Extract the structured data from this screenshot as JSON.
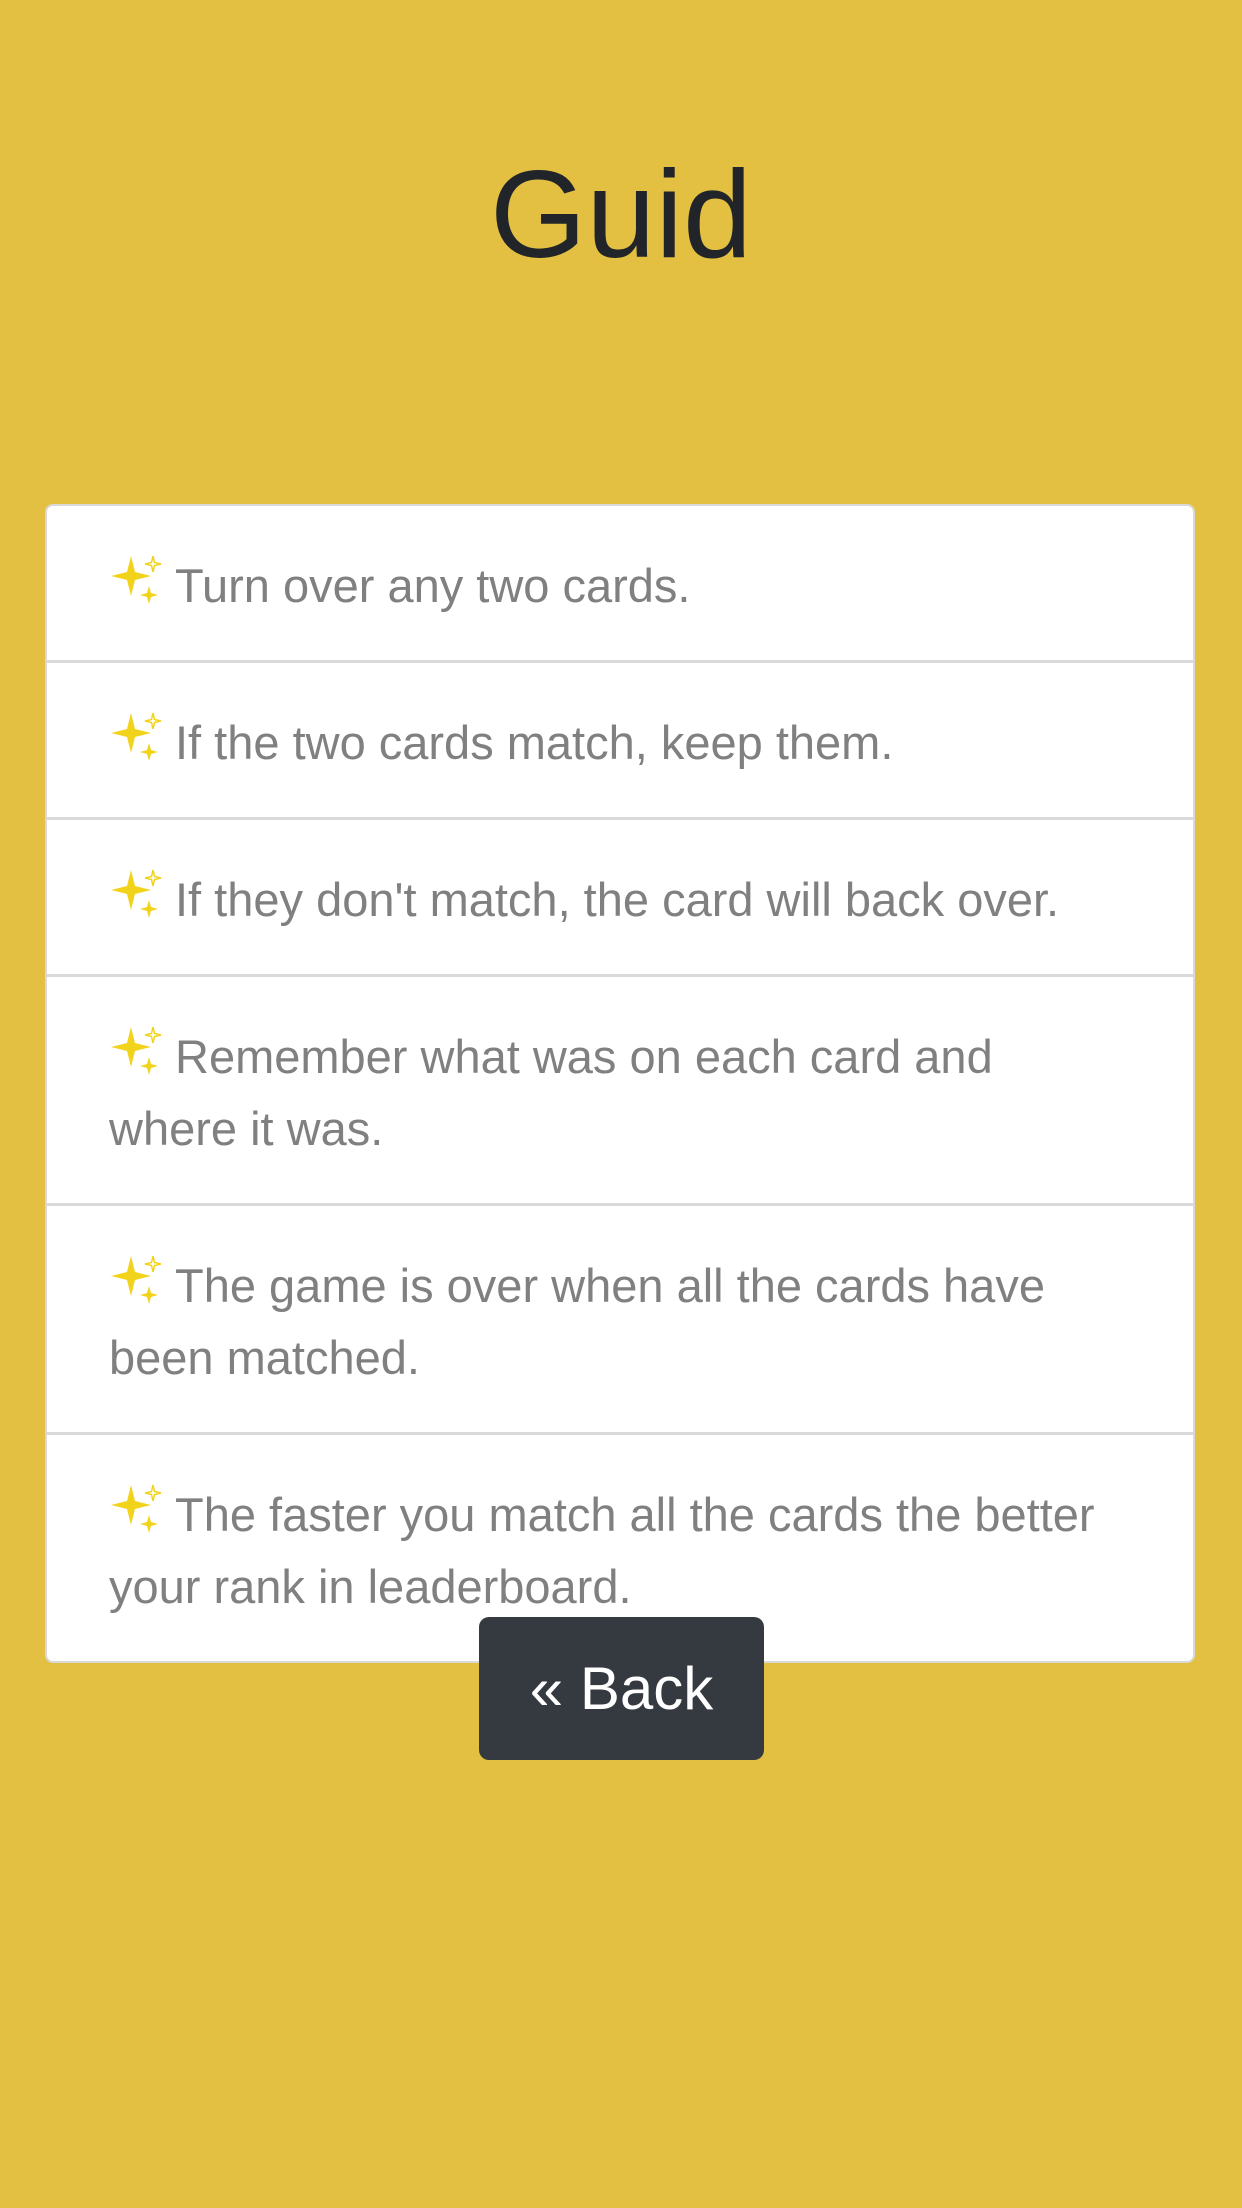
{
  "page": {
    "title": "Guid"
  },
  "guide": {
    "icon": "sparkles-icon",
    "icon_color": "#f2d31b",
    "items": [
      "Turn over any two cards.",
      "If the two cards match, keep them.",
      "If they don't match, the card will back over.",
      "Remember what was on each card and where it was.",
      "The game is over when all the cards have been matched.",
      "The faster you match all the cards the better your rank in leaderboard."
    ]
  },
  "actions": {
    "back_label": "« Back"
  },
  "colors": {
    "background": "#e3c042",
    "button": "#343a40"
  }
}
